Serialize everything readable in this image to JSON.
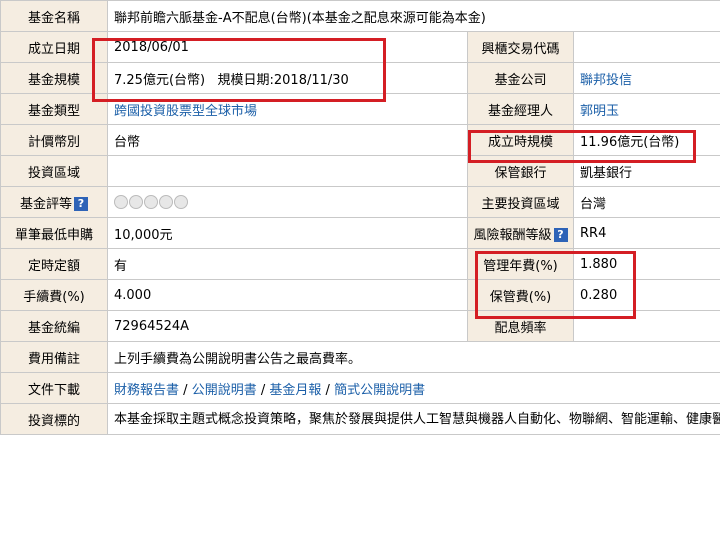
{
  "rows": {
    "name": {
      "label": "基金名稱",
      "value": "聯邦前瞻六脈基金-A不配息(台幣)(本基金之配息來源可能為本金)"
    },
    "inception": {
      "label": "成立日期",
      "value": "2018/06/01",
      "label2": "興櫃交易代碼",
      "value2": ""
    },
    "size": {
      "label": "基金規模",
      "value": "7.25億元(台幣)",
      "date_label": "規模日期:",
      "date": "2018/11/30",
      "label2": "基金公司",
      "value2": "聯邦投信"
    },
    "type": {
      "label": "基金類型",
      "value": "跨國投資股票型全球市場",
      "label2": "基金經理人",
      "value2": "郭明玉"
    },
    "currency": {
      "label": "計價幣別",
      "value": "台幣",
      "label2": "成立時規模",
      "value2": "11.96億元(台幣)"
    },
    "region": {
      "label": "投資區域",
      "value": "",
      "label2": "保管銀行",
      "value2": "凱基銀行"
    },
    "rating": {
      "label": "基金評等",
      "help": "?",
      "label2": "主要投資區域",
      "value2": "台灣"
    },
    "minimum": {
      "label": "單筆最低申購",
      "value": "10,000元",
      "label2": "風險報酬等級",
      "help2": "?",
      "value2": "RR4"
    },
    "regular": {
      "label": "定時定額",
      "value": "有",
      "label2": "管理年費(%)",
      "value2": "1.880"
    },
    "fee": {
      "label": "手續費(%)",
      "value": "4.000",
      "label2": "保管費(%)",
      "value2": "0.280"
    },
    "code": {
      "label": "基金統編",
      "value": "72964524A",
      "label2": "配息頻率",
      "value2": ""
    },
    "note": {
      "label": "費用備註",
      "value": "上列手續費為公開說明書公告之最高費率。"
    },
    "download": {
      "label": "文件下載",
      "links": [
        "財務報告書",
        "公開說明書",
        "基金月報",
        "簡式公開說明書"
      ],
      "sep": "/"
    },
    "objective": {
      "label": "投資標的",
      "value": "本基金採取主題式概念投資策略，聚焦於發展與提供人工智慧與機器人自動化、物聯網、智能運輸、健康醫療、銀髮消費與清潔能源等前瞻產業之相關技術、服務與產品之企業，透過產業產值、成長潛力、供應鏈等面向綜合判斷潛在商機與投資機會以決定各產業的投資優先順序，並配合行業景氣循環，決定產業配置比重。再由各產業中依據其核心技術與商業模式，挑選具有投資價值與成長潛力之投資標的。"
    }
  },
  "colors": {
    "label_bg": "#f5ede1",
    "link": "#1b5fa8",
    "highlight": "#d41e24",
    "border": "#c9c9c9"
  }
}
